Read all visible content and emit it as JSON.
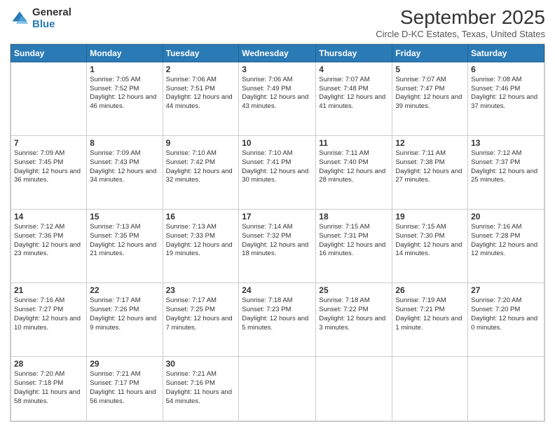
{
  "logo": {
    "general": "General",
    "blue": "Blue"
  },
  "title": "September 2025",
  "subtitle": "Circle D-KC Estates, Texas, United States",
  "days_header": [
    "Sunday",
    "Monday",
    "Tuesday",
    "Wednesday",
    "Thursday",
    "Friday",
    "Saturday"
  ],
  "weeks": [
    [
      {
        "num": "",
        "sunrise": "",
        "sunset": "",
        "daylight": ""
      },
      {
        "num": "1",
        "sunrise": "Sunrise: 7:05 AM",
        "sunset": "Sunset: 7:52 PM",
        "daylight": "Daylight: 12 hours and 46 minutes."
      },
      {
        "num": "2",
        "sunrise": "Sunrise: 7:06 AM",
        "sunset": "Sunset: 7:51 PM",
        "daylight": "Daylight: 12 hours and 44 minutes."
      },
      {
        "num": "3",
        "sunrise": "Sunrise: 7:06 AM",
        "sunset": "Sunset: 7:49 PM",
        "daylight": "Daylight: 12 hours and 43 minutes."
      },
      {
        "num": "4",
        "sunrise": "Sunrise: 7:07 AM",
        "sunset": "Sunset: 7:48 PM",
        "daylight": "Daylight: 12 hours and 41 minutes."
      },
      {
        "num": "5",
        "sunrise": "Sunrise: 7:07 AM",
        "sunset": "Sunset: 7:47 PM",
        "daylight": "Daylight: 12 hours and 39 minutes."
      },
      {
        "num": "6",
        "sunrise": "Sunrise: 7:08 AM",
        "sunset": "Sunset: 7:46 PM",
        "daylight": "Daylight: 12 hours and 37 minutes."
      }
    ],
    [
      {
        "num": "7",
        "sunrise": "Sunrise: 7:09 AM",
        "sunset": "Sunset: 7:45 PM",
        "daylight": "Daylight: 12 hours and 36 minutes."
      },
      {
        "num": "8",
        "sunrise": "Sunrise: 7:09 AM",
        "sunset": "Sunset: 7:43 PM",
        "daylight": "Daylight: 12 hours and 34 minutes."
      },
      {
        "num": "9",
        "sunrise": "Sunrise: 7:10 AM",
        "sunset": "Sunset: 7:42 PM",
        "daylight": "Daylight: 12 hours and 32 minutes."
      },
      {
        "num": "10",
        "sunrise": "Sunrise: 7:10 AM",
        "sunset": "Sunset: 7:41 PM",
        "daylight": "Daylight: 12 hours and 30 minutes."
      },
      {
        "num": "11",
        "sunrise": "Sunrise: 7:11 AM",
        "sunset": "Sunset: 7:40 PM",
        "daylight": "Daylight: 12 hours and 28 minutes."
      },
      {
        "num": "12",
        "sunrise": "Sunrise: 7:11 AM",
        "sunset": "Sunset: 7:38 PM",
        "daylight": "Daylight: 12 hours and 27 minutes."
      },
      {
        "num": "13",
        "sunrise": "Sunrise: 7:12 AM",
        "sunset": "Sunset: 7:37 PM",
        "daylight": "Daylight: 12 hours and 25 minutes."
      }
    ],
    [
      {
        "num": "14",
        "sunrise": "Sunrise: 7:12 AM",
        "sunset": "Sunset: 7:36 PM",
        "daylight": "Daylight: 12 hours and 23 minutes."
      },
      {
        "num": "15",
        "sunrise": "Sunrise: 7:13 AM",
        "sunset": "Sunset: 7:35 PM",
        "daylight": "Daylight: 12 hours and 21 minutes."
      },
      {
        "num": "16",
        "sunrise": "Sunrise: 7:13 AM",
        "sunset": "Sunset: 7:33 PM",
        "daylight": "Daylight: 12 hours and 19 minutes."
      },
      {
        "num": "17",
        "sunrise": "Sunrise: 7:14 AM",
        "sunset": "Sunset: 7:32 PM",
        "daylight": "Daylight: 12 hours and 18 minutes."
      },
      {
        "num": "18",
        "sunrise": "Sunrise: 7:15 AM",
        "sunset": "Sunset: 7:31 PM",
        "daylight": "Daylight: 12 hours and 16 minutes."
      },
      {
        "num": "19",
        "sunrise": "Sunrise: 7:15 AM",
        "sunset": "Sunset: 7:30 PM",
        "daylight": "Daylight: 12 hours and 14 minutes."
      },
      {
        "num": "20",
        "sunrise": "Sunrise: 7:16 AM",
        "sunset": "Sunset: 7:28 PM",
        "daylight": "Daylight: 12 hours and 12 minutes."
      }
    ],
    [
      {
        "num": "21",
        "sunrise": "Sunrise: 7:16 AM",
        "sunset": "Sunset: 7:27 PM",
        "daylight": "Daylight: 12 hours and 10 minutes."
      },
      {
        "num": "22",
        "sunrise": "Sunrise: 7:17 AM",
        "sunset": "Sunset: 7:26 PM",
        "daylight": "Daylight: 12 hours and 9 minutes."
      },
      {
        "num": "23",
        "sunrise": "Sunrise: 7:17 AM",
        "sunset": "Sunset: 7:25 PM",
        "daylight": "Daylight: 12 hours and 7 minutes."
      },
      {
        "num": "24",
        "sunrise": "Sunrise: 7:18 AM",
        "sunset": "Sunset: 7:23 PM",
        "daylight": "Daylight: 12 hours and 5 minutes."
      },
      {
        "num": "25",
        "sunrise": "Sunrise: 7:18 AM",
        "sunset": "Sunset: 7:22 PM",
        "daylight": "Daylight: 12 hours and 3 minutes."
      },
      {
        "num": "26",
        "sunrise": "Sunrise: 7:19 AM",
        "sunset": "Sunset: 7:21 PM",
        "daylight": "Daylight: 12 hours and 1 minute."
      },
      {
        "num": "27",
        "sunrise": "Sunrise: 7:20 AM",
        "sunset": "Sunset: 7:20 PM",
        "daylight": "Daylight: 12 hours and 0 minutes."
      }
    ],
    [
      {
        "num": "28",
        "sunrise": "Sunrise: 7:20 AM",
        "sunset": "Sunset: 7:18 PM",
        "daylight": "Daylight: 11 hours and 58 minutes."
      },
      {
        "num": "29",
        "sunrise": "Sunrise: 7:21 AM",
        "sunset": "Sunset: 7:17 PM",
        "daylight": "Daylight: 11 hours and 56 minutes."
      },
      {
        "num": "30",
        "sunrise": "Sunrise: 7:21 AM",
        "sunset": "Sunset: 7:16 PM",
        "daylight": "Daylight: 11 hours and 54 minutes."
      },
      {
        "num": "",
        "sunrise": "",
        "sunset": "",
        "daylight": ""
      },
      {
        "num": "",
        "sunrise": "",
        "sunset": "",
        "daylight": ""
      },
      {
        "num": "",
        "sunrise": "",
        "sunset": "",
        "daylight": ""
      },
      {
        "num": "",
        "sunrise": "",
        "sunset": "",
        "daylight": ""
      }
    ]
  ]
}
